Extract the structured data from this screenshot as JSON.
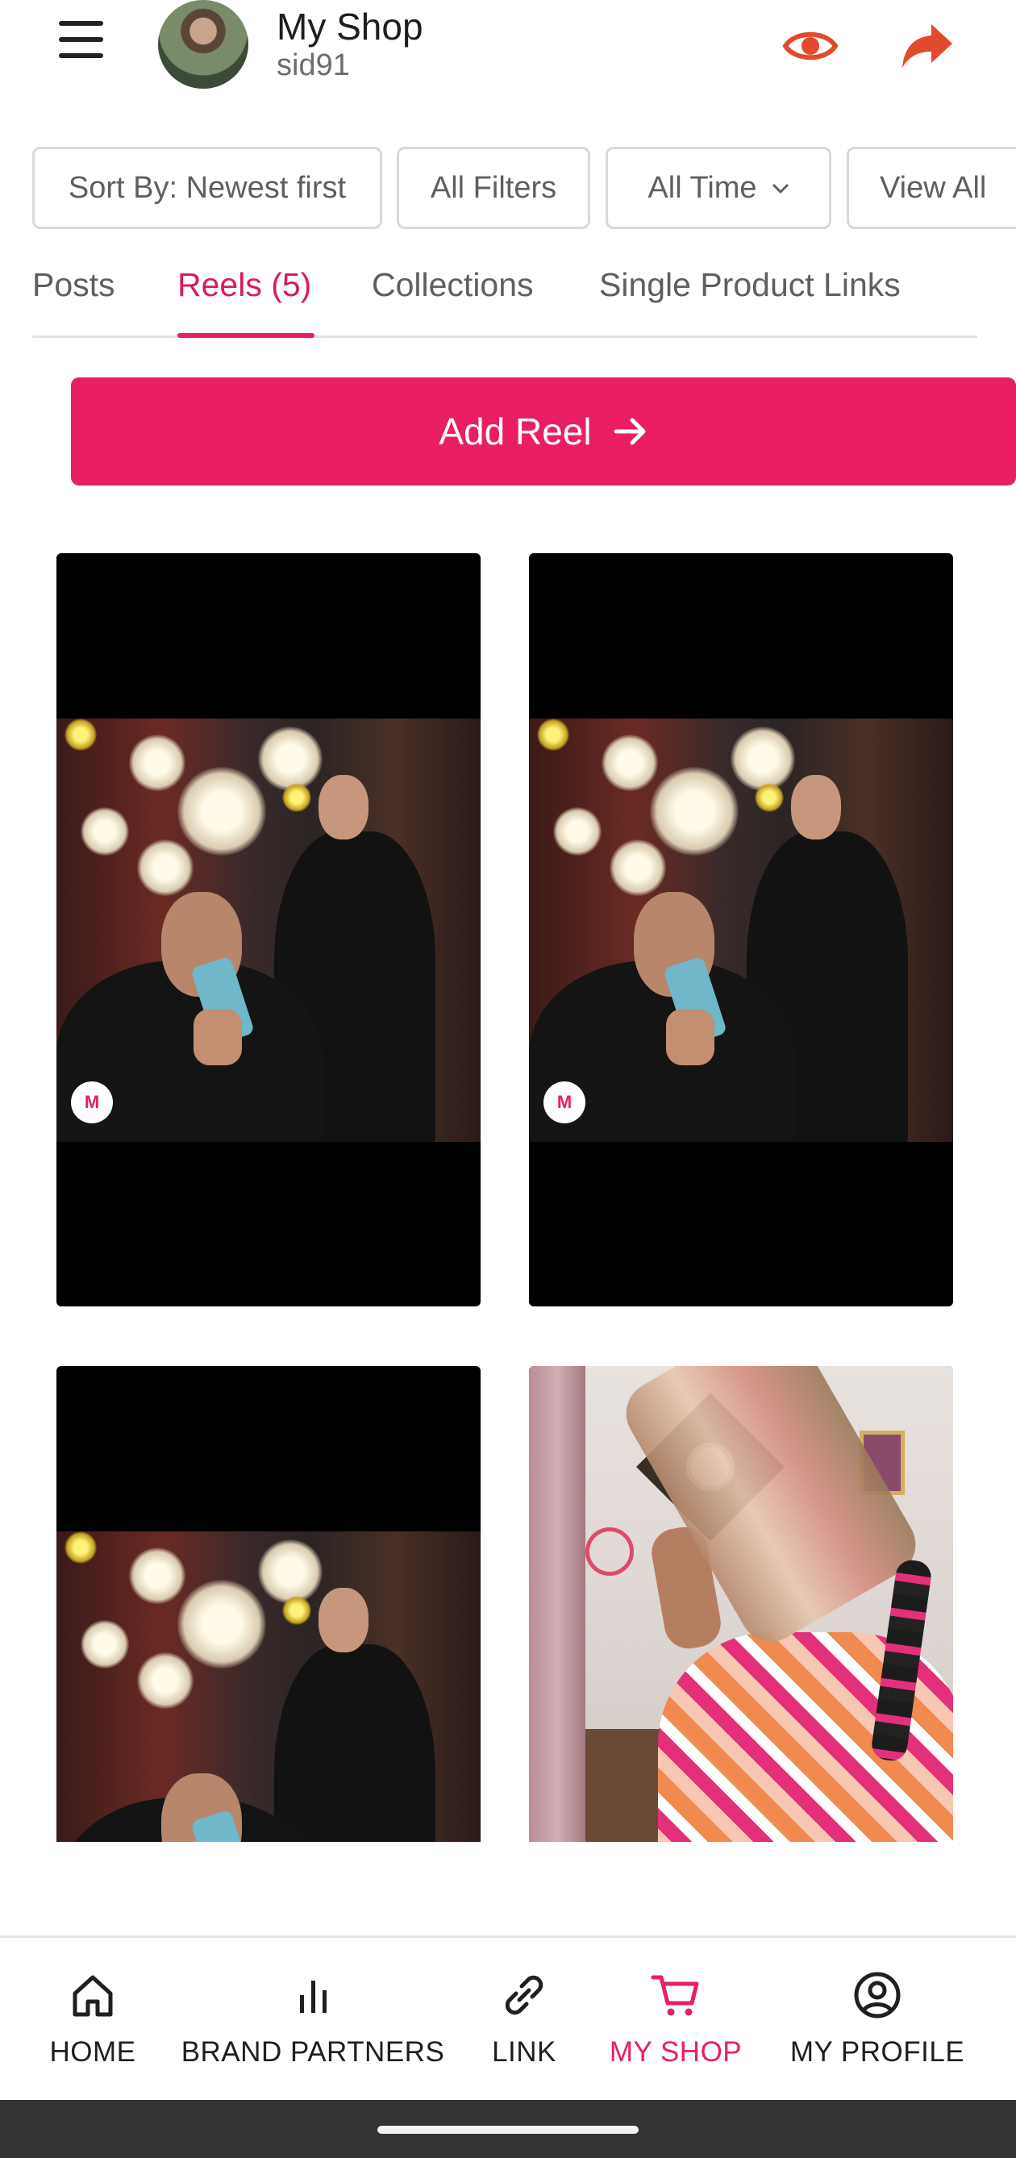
{
  "header": {
    "title": "My Shop",
    "username": "sid91",
    "icons": [
      "menu-icon",
      "avatar",
      "eye-icon",
      "share-icon"
    ],
    "accent_color": "#e24a2e"
  },
  "filters": {
    "sort": "Sort By: Newest first",
    "all_filters": "All Filters",
    "time": "All Time",
    "view": "View All"
  },
  "tabs": [
    {
      "label": "Posts",
      "active": false
    },
    {
      "label": "Reels (5)",
      "active": true
    },
    {
      "label": "Collections",
      "active": false
    },
    {
      "label": "Single Product Links",
      "active": false
    }
  ],
  "add_reel": {
    "label": "Add Reel",
    "color": "#e91e63"
  },
  "reels": [
    {
      "badge": "M"
    },
    {
      "badge": "M"
    },
    {
      "badge": ""
    },
    {
      "badge": ""
    }
  ],
  "bottom_nav": [
    {
      "label": "HOME",
      "icon": "home-icon",
      "active": false
    },
    {
      "label": "BRAND PARTNERS",
      "icon": "bar-chart-icon",
      "active": false
    },
    {
      "label": "LINK",
      "icon": "link-icon",
      "active": false
    },
    {
      "label": "MY SHOP",
      "icon": "cart-icon",
      "active": true
    },
    {
      "label": "MY PROFILE",
      "icon": "profile-icon",
      "active": false
    }
  ]
}
